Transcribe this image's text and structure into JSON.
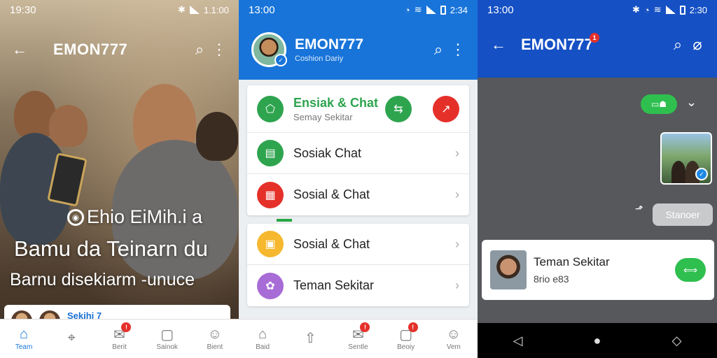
{
  "panel1": {
    "status": {
      "time": "19:30",
      "right": "1.1:00"
    },
    "app_title": "EMON777",
    "hero": {
      "line1": "Ehio EiMih.i a",
      "line2": "Bamu da Teinarn du",
      "line3": "Barnu disekiarm -unuce"
    },
    "card": {
      "label": "Sekihi 7"
    },
    "nav": [
      {
        "label": "Team",
        "icon": "home-icon",
        "active": true
      },
      {
        "label": "",
        "icon": "location-pin-icon"
      },
      {
        "label": "Berit",
        "icon": "mail-icon",
        "badge": "!"
      },
      {
        "label": "Sainok",
        "icon": "chat-icon"
      },
      {
        "label": "Bient",
        "icon": "profile-icon"
      }
    ]
  },
  "panel2": {
    "status": {
      "time": "13:00",
      "right": "2:34"
    },
    "profile": {
      "name": "EMON777",
      "subtitle": "Coshion Dariy"
    },
    "items_top": [
      {
        "label": "Ensiak & Chat",
        "sub": "Semay Sekitar",
        "color": "#2ea44f"
      },
      {
        "label": "Sosiak Chat",
        "color": "#2ea44f"
      },
      {
        "label": "Sosial & Chat",
        "color": "#e5302a"
      }
    ],
    "items_bottom": [
      {
        "label": "Sosial & Chat",
        "color": "#f5b82e"
      },
      {
        "label": "Teman Sekitar",
        "color": "#a86cd6"
      }
    ],
    "nav": [
      {
        "label": "Baid",
        "icon": "home-icon"
      },
      {
        "label": "",
        "icon": "send-icon"
      },
      {
        "label": "Sentle",
        "icon": "mail-icon",
        "badge": "!"
      },
      {
        "label": "Beoiy",
        "icon": "chat-icon",
        "badge": "!"
      },
      {
        "label": "Vem",
        "icon": "profile-icon"
      }
    ]
  },
  "panel3": {
    "status": {
      "time": "13:00",
      "right": "2:30"
    },
    "title": "EMON777",
    "title_badge": "1",
    "bubble": "Stanoer",
    "card": {
      "name": "Teman Sekitar",
      "sub": "8rio e83"
    }
  },
  "colors": {
    "blue": "#1874d9",
    "dark_blue": "#1550c4",
    "green": "#2fbf4f",
    "red": "#e5302a"
  }
}
